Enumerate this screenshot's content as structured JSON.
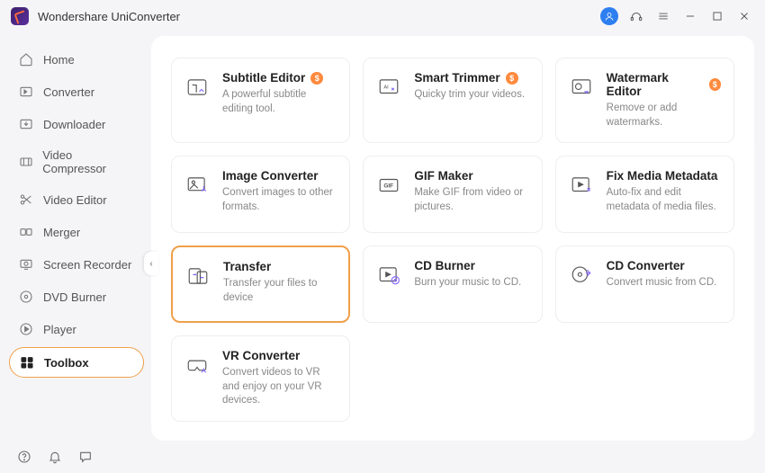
{
  "app": {
    "title": "Wondershare UniConverter"
  },
  "sidebar": {
    "items": [
      {
        "label": "Home"
      },
      {
        "label": "Converter"
      },
      {
        "label": "Downloader"
      },
      {
        "label": "Video Compressor"
      },
      {
        "label": "Video Editor"
      },
      {
        "label": "Merger"
      },
      {
        "label": "Screen Recorder"
      },
      {
        "label": "DVD Burner"
      },
      {
        "label": "Player"
      },
      {
        "label": "Toolbox"
      }
    ]
  },
  "tools": [
    {
      "title": "Subtitle Editor",
      "desc": "A powerful subtitle editing tool.",
      "badge": "$"
    },
    {
      "title": "Smart Trimmer",
      "desc": "Quicky trim your videos.",
      "badge": "$"
    },
    {
      "title": "Watermark Editor",
      "desc": "Remove or add watermarks.",
      "badge": "$"
    },
    {
      "title": "Image Converter",
      "desc": "Convert images to other formats."
    },
    {
      "title": "GIF Maker",
      "desc": "Make GIF from video or pictures."
    },
    {
      "title": "Fix Media Metadata",
      "desc": "Auto-fix and edit metadata of media files."
    },
    {
      "title": "Transfer",
      "desc": "Transfer your files to device"
    },
    {
      "title": "CD Burner",
      "desc": "Burn your music to CD."
    },
    {
      "title": "CD Converter",
      "desc": "Convert music from CD."
    },
    {
      "title": "VR Converter",
      "desc": "Convert videos to VR and enjoy on your VR devices."
    }
  ]
}
